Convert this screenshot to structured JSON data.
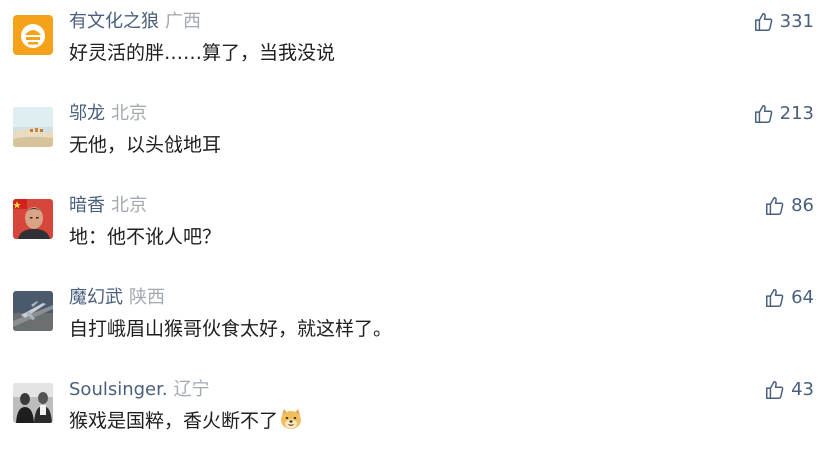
{
  "comments": [
    {
      "username": "有文化之狼",
      "location": "广西",
      "text": "好灵活的胖……算了，当我没说",
      "likes": "331",
      "avatar": "fox-logo-avatar"
    },
    {
      "username": "邬龙",
      "location": "北京",
      "text": "无他，以头戗地耳",
      "likes": "213",
      "avatar": "desert-camels-avatar"
    },
    {
      "username": "暗香",
      "location": "北京",
      "text": "地：他不讹人吧？",
      "likes": "86",
      "avatar": "man-portrait-flag-avatar"
    },
    {
      "username": "魔幻武",
      "location": "陕西",
      "text": "自打峨眉山猴哥伙食太好，就这样了。",
      "likes": "64",
      "avatar": "aircraft-avatar"
    },
    {
      "username": "Soulsinger.",
      "location": "辽宁",
      "text": "猴戏是国粹，香火断不了",
      "likes": "43",
      "avatar": "bw-photo-avatar",
      "emoji": "doge-emoji"
    }
  ],
  "colors": {
    "username": "#4a5f7e",
    "location": "#a3a9b1",
    "text": "#1f1f1f",
    "like": "#4a5f7e"
  },
  "icons": {
    "like": "thumbs-up-icon"
  }
}
